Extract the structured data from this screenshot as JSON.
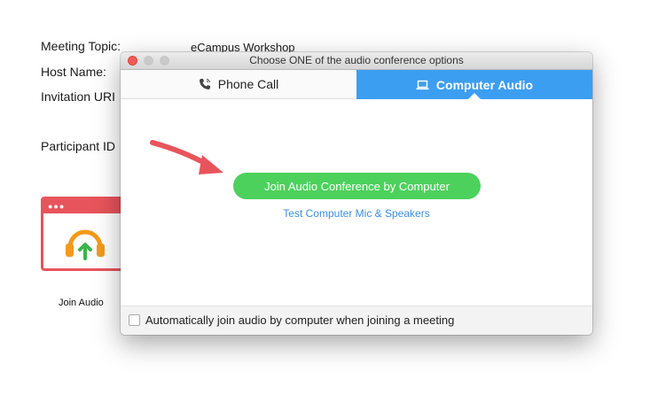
{
  "background": {
    "meeting_topic_label": "Meeting Topic:",
    "meeting_topic_value": "eCampus Workshop",
    "host_name_label": "Host Name:",
    "invitation_label": "Invitation URI",
    "participant_id_label": "Participant ID",
    "join_audio_label": "Join Audio"
  },
  "dialog": {
    "title": "Choose ONE of the audio conference options",
    "tabs": [
      {
        "label": "Phone Call",
        "icon": "phone-icon",
        "active": false
      },
      {
        "label": "Computer Audio",
        "icon": "laptop-icon",
        "active": true
      }
    ],
    "join_button_label": "Join Audio Conference by Computer",
    "test_link_label": "Test Computer Mic & Speakers",
    "auto_join_label": "Automatically join audio by computer when joining a meeting",
    "auto_join_checked": false
  },
  "colors": {
    "accent_blue": "#3c9ef1",
    "join_green": "#4cd15c",
    "arrow_red": "#e8545c",
    "link_blue": "#3c8fe0"
  }
}
